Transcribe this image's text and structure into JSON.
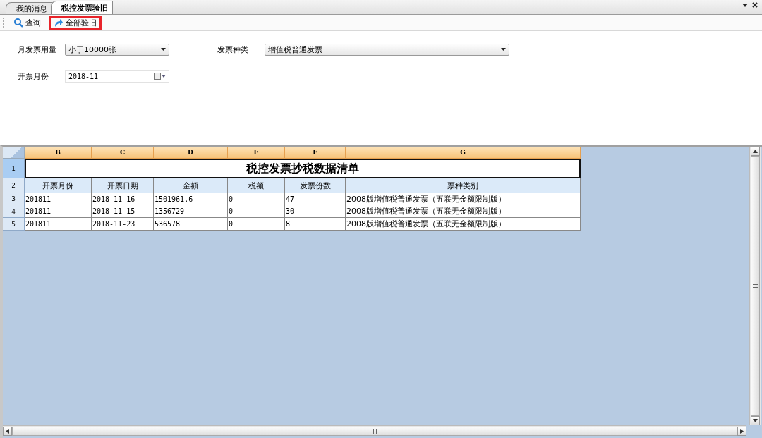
{
  "tabs": [
    {
      "label": "我的消息",
      "selected": false
    },
    {
      "label": "税控发票验旧",
      "selected": true
    }
  ],
  "toolbar": [
    {
      "kind": "search",
      "label": "查询",
      "highlighted": false
    },
    {
      "kind": "redo",
      "label": "全部验旧",
      "highlighted": true
    }
  ],
  "form": {
    "monthly_usage": {
      "label": "月发票用量",
      "value": "小于10000张"
    },
    "invoice_type": {
      "label": "发票种类",
      "value": "增值税普通发票"
    },
    "billing_month": {
      "label": "开票月份",
      "value": "2018-11"
    }
  },
  "sheet": {
    "columns": [
      "B",
      "C",
      "D",
      "E",
      "F",
      "G"
    ],
    "row_numbers": [
      "1",
      "2",
      "3",
      "4",
      "5"
    ],
    "title": "税控发票抄税数据清单",
    "headers": [
      "开票月份",
      "开票日期",
      "金额",
      "税额",
      "发票份数",
      "票种类别"
    ],
    "rows": [
      [
        "201811",
        "2018-11-16",
        "1501961.6",
        "0",
        "47",
        "2008版增值税普通发票（五联无金额限制版）"
      ],
      [
        "201811",
        "2018-11-15",
        "1356729",
        "0",
        "30",
        "2008版增值税普通发票（五联无金额限制版）"
      ],
      [
        "201811",
        "2018-11-23",
        "536578",
        "0",
        "8",
        "2008版增值税普通发票（五联无金额限制版）"
      ]
    ]
  }
}
